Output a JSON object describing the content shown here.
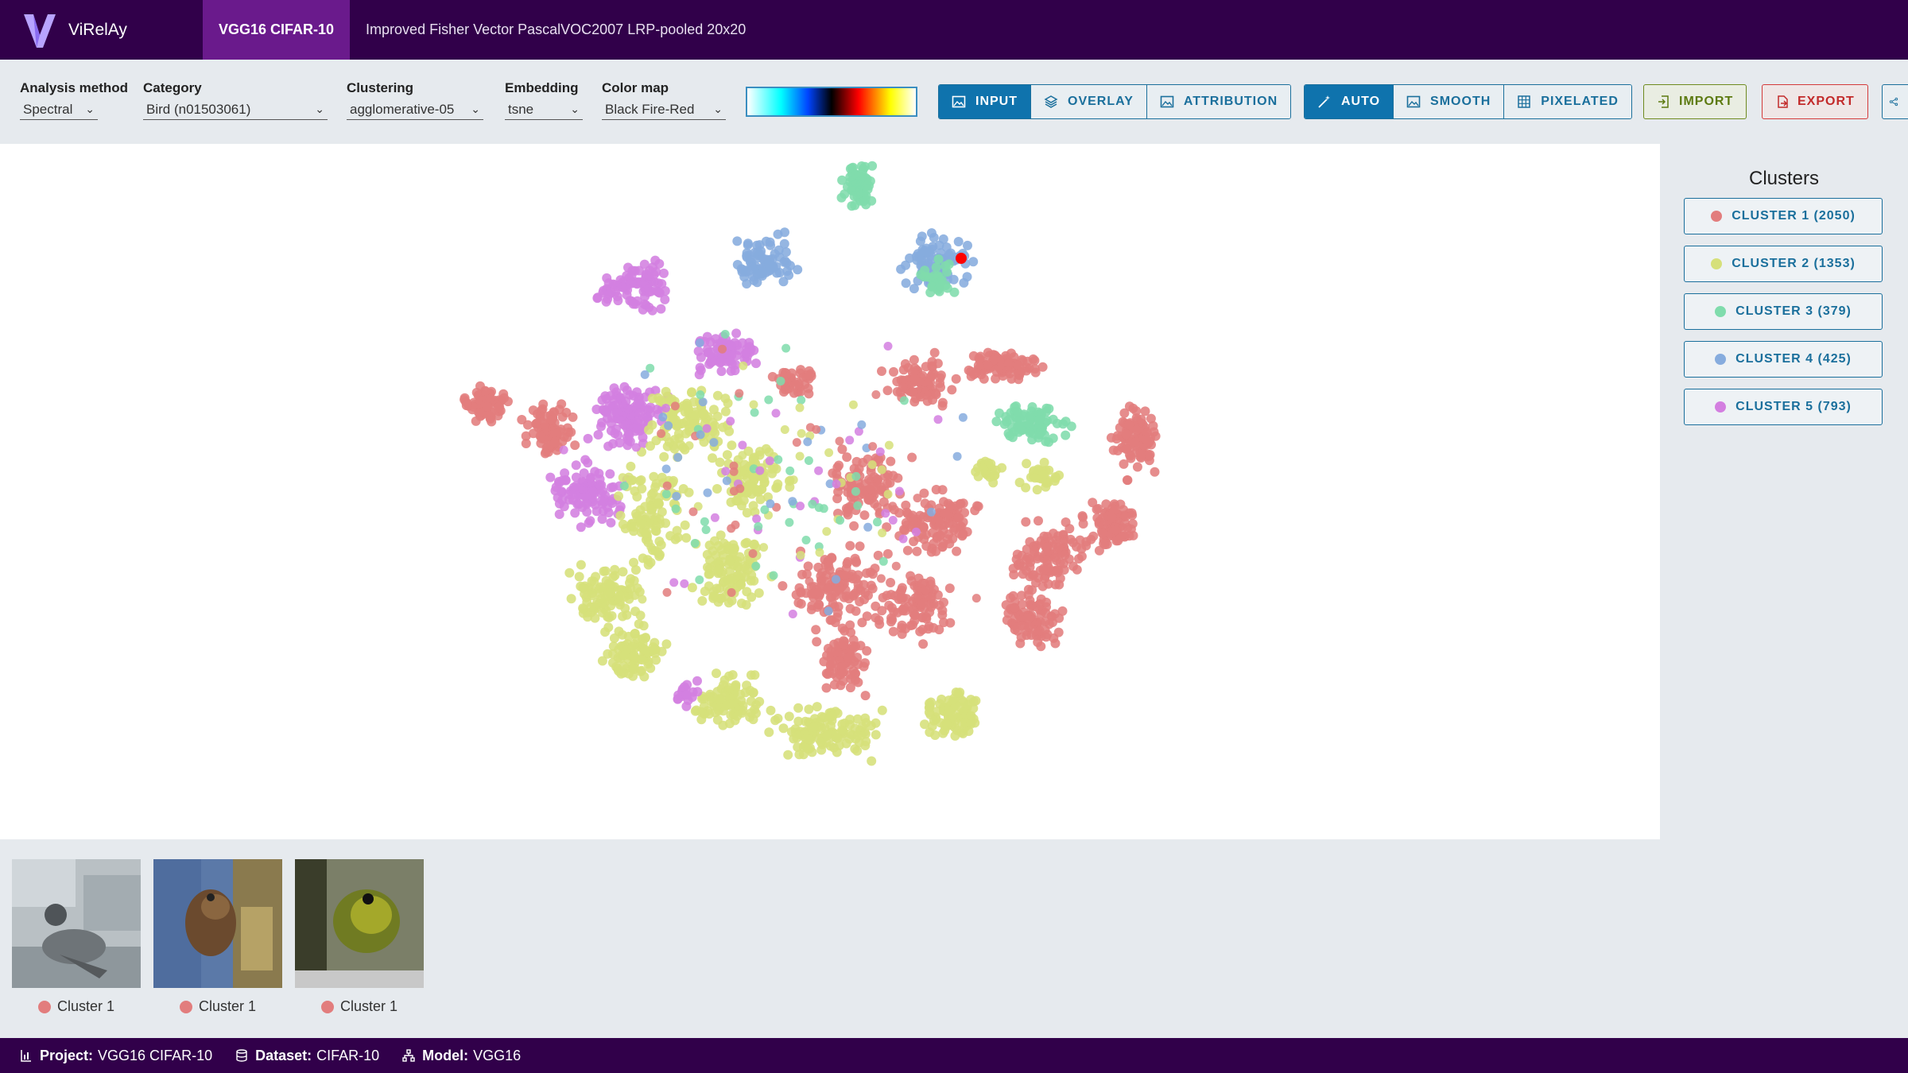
{
  "header": {
    "app_name": "ViRelAy",
    "tabs": [
      {
        "label": "VGG16 CIFAR-10",
        "active": true
      },
      {
        "label": "Improved Fisher Vector PascalVOC2007 LRP-pooled 20x20",
        "active": false
      }
    ],
    "bg_color": "#31004a",
    "active_tab_color": "#6a1a8c"
  },
  "toolbar": {
    "analysis_method": {
      "label": "Analysis method",
      "value": "Spectral"
    },
    "category": {
      "label": "Category",
      "value": "Bird (n01503061)"
    },
    "clustering": {
      "label": "Clustering",
      "value": "agglomerative-05"
    },
    "embedding": {
      "label": "Embedding",
      "value": "tsne"
    },
    "color_map": {
      "label": "Color map",
      "value": "Black Fire-Red"
    },
    "view_buttons": [
      {
        "label": "INPUT",
        "icon": "image-icon",
        "active": true
      },
      {
        "label": "OVERLAY",
        "icon": "layers-icon",
        "active": false
      },
      {
        "label": "ATTRIBUTION",
        "icon": "image-icon",
        "active": false
      }
    ],
    "render_buttons": [
      {
        "label": "AUTO",
        "icon": "magic-wand-icon",
        "active": true
      },
      {
        "label": "SMOOTH",
        "icon": "image-icon",
        "active": false
      },
      {
        "label": "PIXELATED",
        "icon": "grid-icon",
        "active": false
      }
    ],
    "import_label": "IMPORT",
    "export_label": "EXPORT"
  },
  "clusters": {
    "title": "Clusters",
    "items": [
      {
        "label": "CLUSTER 1 (2050)",
        "color": "#e27d7d"
      },
      {
        "label": "CLUSTER 2 (1353)",
        "color": "#d6e07a"
      },
      {
        "label": "CLUSTER 3 (379)",
        "color": "#7fdcac"
      },
      {
        "label": "CLUSTER 4 (425)",
        "color": "#86acde"
      },
      {
        "label": "CLUSTER 5 (793)",
        "color": "#d37fe0"
      }
    ],
    "highlight_color": "#ff0000"
  },
  "thumbnails": [
    {
      "caption": "Cluster 1"
    },
    {
      "caption": "Cluster 1"
    },
    {
      "caption": "Cluster 1"
    }
  ],
  "footer": {
    "project_label": "Project:",
    "project_value": "VGG16 CIFAR-10",
    "dataset_label": "Dataset:",
    "dataset_value": "CIFAR-10",
    "model_label": "Model:",
    "model_value": "VGG16"
  }
}
